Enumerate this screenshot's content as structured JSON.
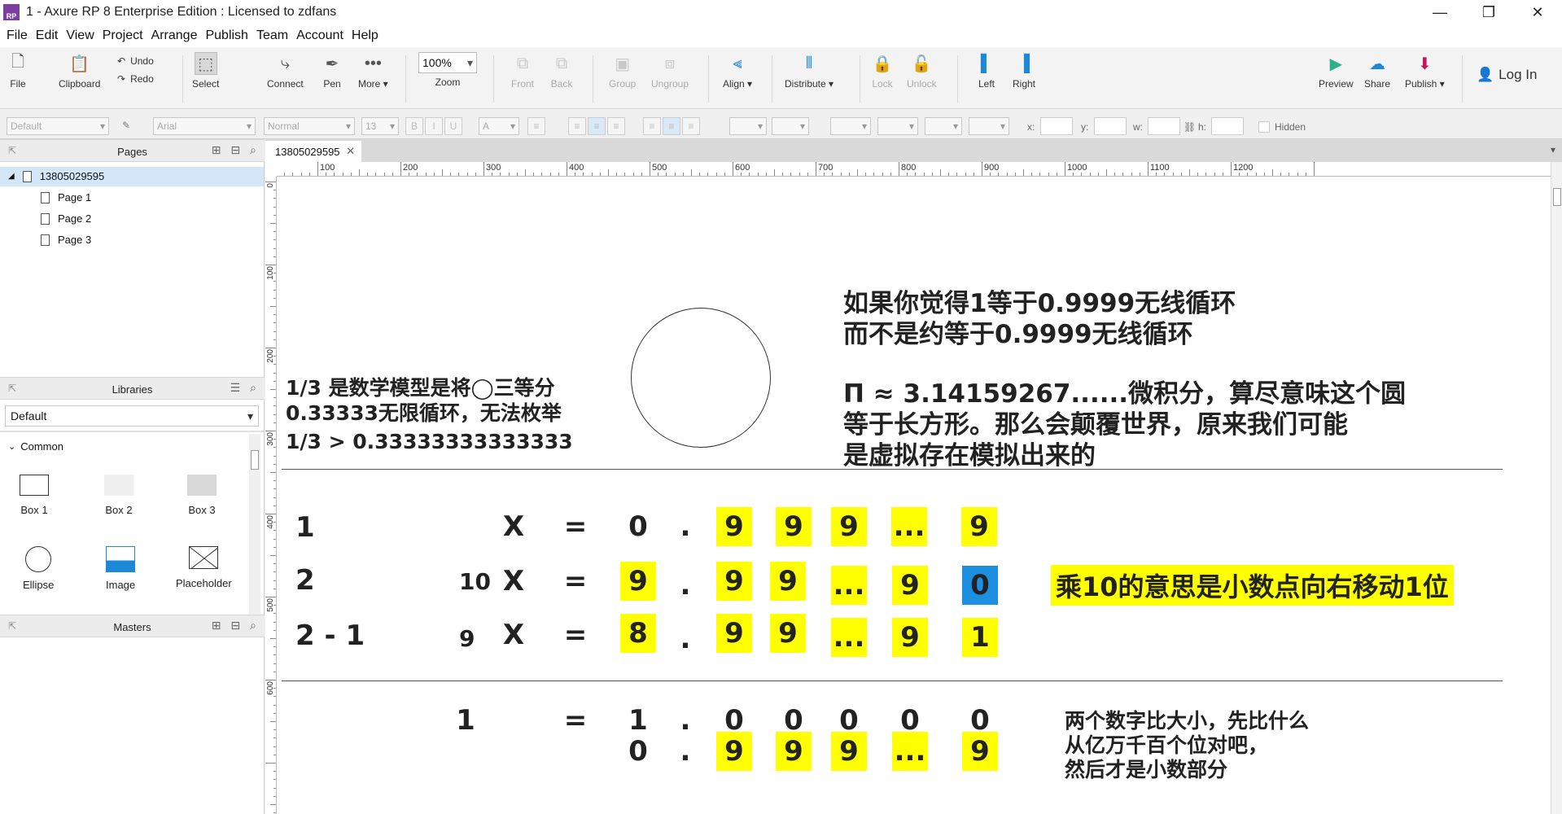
{
  "window": {
    "title": "1 - Axure RP 8 Enterprise Edition : Licensed to zdfans",
    "app_icon": "RP"
  },
  "menu": [
    "File",
    "Edit",
    "View",
    "Project",
    "Arrange",
    "Publish",
    "Team",
    "Account",
    "Help"
  ],
  "toolbar": {
    "file": "File",
    "clipboard": "Clipboard",
    "undo": "Undo",
    "redo": "Redo",
    "select": "Select",
    "connect": "Connect",
    "pen": "Pen",
    "more": "More ▾",
    "zoom_value": "100%",
    "zoom": "Zoom",
    "front": "Front",
    "back": "Back",
    "group": "Group",
    "ungroup": "Ungroup",
    "align": "Align ▾",
    "distribute": "Distribute ▾",
    "lock": "Lock",
    "unlock": "Unlock",
    "left": "Left",
    "right": "Right",
    "preview": "Preview",
    "share": "Share",
    "publish": "Publish ▾",
    "login": "Log In"
  },
  "formatbar": {
    "style": "Default",
    "font": "Arial",
    "weight": "Normal",
    "size": "13",
    "x": "x:",
    "y": "y:",
    "w": "w:",
    "h": "h:",
    "hidden": "Hidden"
  },
  "pages_panel": {
    "title": "Pages",
    "root": "13805029595",
    "items": [
      "Page 1",
      "Page 2",
      "Page 3"
    ]
  },
  "libraries_panel": {
    "title": "Libraries",
    "selected": "Default",
    "group": "Common",
    "widgets": [
      {
        "label": "Box 1"
      },
      {
        "label": "Box 2"
      },
      {
        "label": "Box 3"
      },
      {
        "label": "Ellipse"
      },
      {
        "label": "Image"
      },
      {
        "label": "Placeholder"
      }
    ]
  },
  "masters_panel": {
    "title": "Masters"
  },
  "canvas": {
    "tab": "13805029595",
    "ruler_h": [
      "100",
      "200",
      "300",
      "400",
      "500",
      "600",
      "700",
      "800",
      "900",
      "1000",
      "1100",
      "1200"
    ],
    "ruler_v": [
      "0",
      "100",
      "200",
      "300",
      "400",
      "500",
      "600"
    ],
    "left_text": [
      "1/3  是数学模型是将◯三等分",
      "0.33333无限循环，无法枚举"
    ],
    "compare": "1/3   >  0.33333333333333",
    "right_text": [
      "如果你觉得1等于0.9999无线循环",
      "而不是约等于0.9999无线循环"
    ],
    "pi_text": [
      "Π ≈  3.14159267......微积分，算尽意味这个圆",
      "等于长方形。那么会颠覆世界，原来我们可能",
      "是虚拟存在模拟出来的"
    ],
    "row1": {
      "label": "1",
      "var": "X",
      "eq": "=",
      "lead": "0",
      "dot": ".",
      "d1": "9",
      "d2": "9",
      "d3": "9",
      "dots": "...",
      "last": "9"
    },
    "row2": {
      "label": "2",
      "coef": "10",
      "var": "X",
      "eq": "=",
      "lead": "9",
      "dot": ".",
      "d1": "9",
      "d2": "9",
      "dots": "...",
      "d3": "9",
      "last": "0"
    },
    "row3": {
      "label": "2 - 1",
      "coef": "9",
      "var": "X",
      "eq": "=",
      "lead": "8",
      "dot": ".",
      "d1": "9",
      "d2": "9",
      "dots": "...",
      "d3": "9",
      "last": "1"
    },
    "note": "乘10的意思是小数点向右移动1位",
    "row4": {
      "a": "1",
      "eq": "=",
      "lead": "1",
      "dot": ".",
      "z1": "0",
      "z2": "0",
      "z3": "0",
      "z4": "0",
      "z5": "0"
    },
    "row5": {
      "lead": "0",
      "dot": ".",
      "d1": "9",
      "d2": "9",
      "d3": "9",
      "dots": "...",
      "last": "9"
    },
    "bottom_text": [
      "两个数字比大小，先比什么",
      "从亿万千百个位对吧，",
      "然后才是小数部分"
    ]
  }
}
